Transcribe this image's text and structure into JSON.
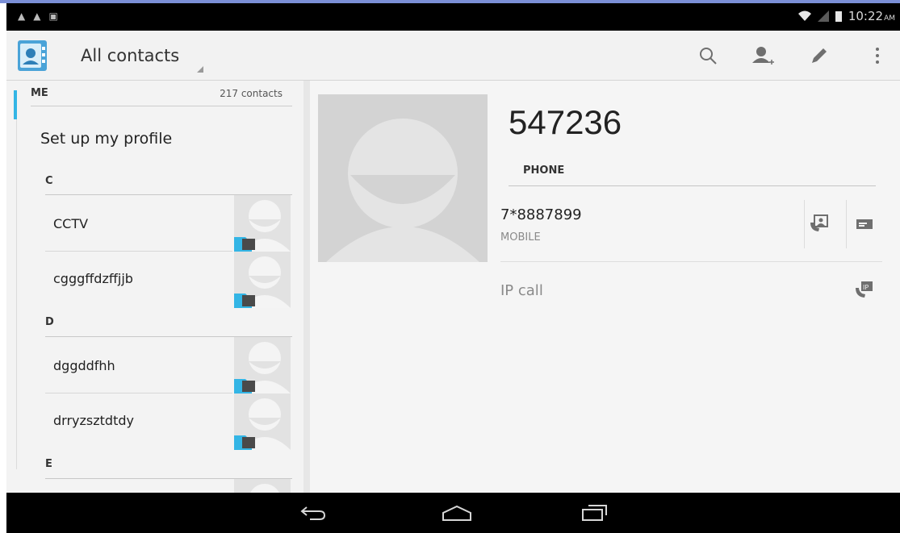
{
  "status_bar": {
    "time": "10:22",
    "ampm": "AM"
  },
  "action_bar": {
    "title": "All contacts",
    "icons": [
      "search-icon",
      "add-contact-icon",
      "edit-icon",
      "overflow-menu-icon"
    ]
  },
  "contact_list": {
    "me_header": "ME",
    "contact_count": "217 contacts",
    "setup_profile": "Set up my profile",
    "sections": [
      {
        "letter": "C",
        "contacts": [
          "CCTV",
          "cgggffdzffjjb"
        ]
      },
      {
        "letter": "D",
        "contacts": [
          "dggddfhh",
          "drryzsztdtdy"
        ]
      },
      {
        "letter": "E",
        "contacts": []
      }
    ]
  },
  "detail": {
    "name": "547236",
    "phone_header": "PHONE",
    "phone_number": "7*8887899",
    "phone_type": "MOBILE",
    "ip_call_label": "IP call",
    "accent": "#33b5e5"
  },
  "nav_bar": {
    "icons": [
      "back-icon",
      "home-icon",
      "recent-apps-icon"
    ]
  }
}
